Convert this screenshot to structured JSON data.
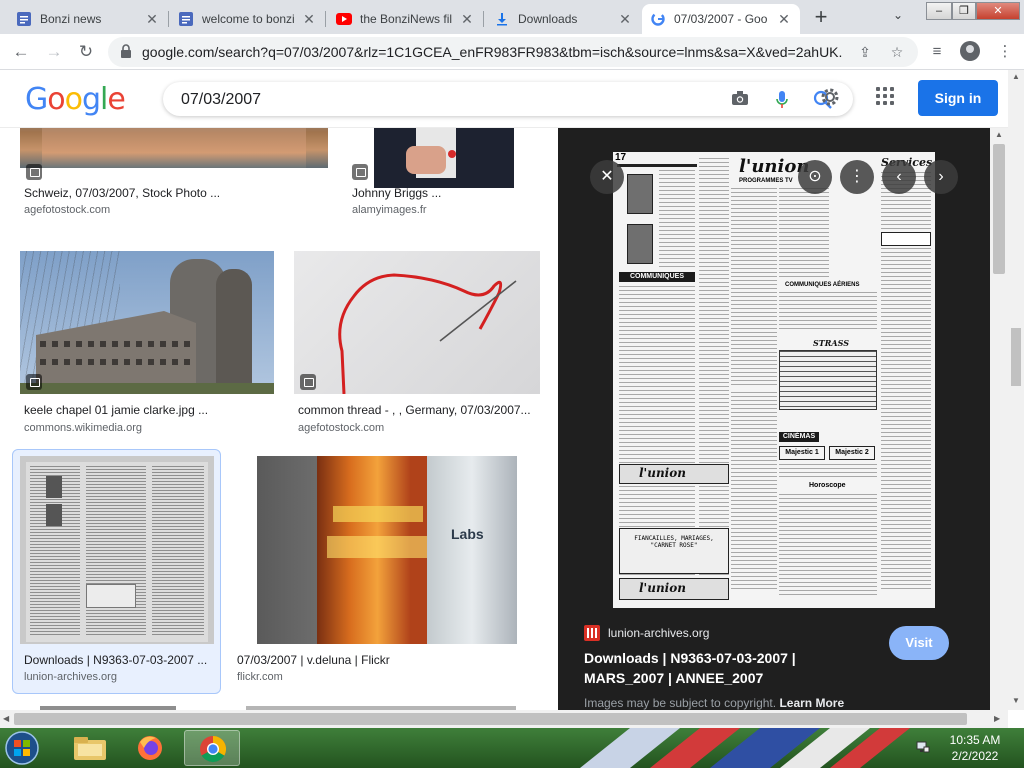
{
  "tabs": [
    {
      "title": "Bonzi news",
      "icon": "docs-icon"
    },
    {
      "title": "welcome to bonzi",
      "icon": "docs-icon"
    },
    {
      "title": "the BonziNews fil",
      "icon": "youtube-icon"
    },
    {
      "title": "Downloads",
      "icon": "download-icon"
    },
    {
      "title": "07/03/2007 - Goo",
      "icon": "google-icon",
      "active": true
    }
  ],
  "window_controls": {
    "minimize": "–",
    "maximize": "❐",
    "close": "✕"
  },
  "address_bar": {
    "url": "google.com/search?q=07/03/2007&rlz=1C1GCEA_enFR983FR983&tbm=isch&source=lnms&sa=X&ved=2ahUK..."
  },
  "google": {
    "logo_letters": [
      {
        "ch": "G",
        "color": "#4285f4"
      },
      {
        "ch": "o",
        "color": "#ea4335"
      },
      {
        "ch": "o",
        "color": "#fbbc05"
      },
      {
        "ch": "g",
        "color": "#4285f4"
      },
      {
        "ch": "l",
        "color": "#34a853"
      },
      {
        "ch": "e",
        "color": "#ea4335"
      }
    ],
    "query": "07/03/2007",
    "signin_label": "Sign in"
  },
  "results": [
    {
      "caption": "Schweiz, 07/03/2007, Stock Photo ...",
      "source": "agefotostock.com"
    },
    {
      "caption": "Johnny Briggs ...",
      "source": "alamyimages.fr"
    },
    {
      "caption": "keele chapel 01 jamie clarke.jpg ...",
      "source": "commons.wikimedia.org"
    },
    {
      "caption": "common thread - , , Germany, 07/03/2007...",
      "source": "agefotostock.com"
    },
    {
      "caption": "Downloads | N9363-07-03-2007 ...",
      "source": "lunion-archives.org"
    },
    {
      "caption": "07/03/2007 | v.deluna | Flickr",
      "source": "flickr.com"
    }
  ],
  "preview": {
    "site": "lunion-archives.org",
    "title": "Downloads | N9363-07-03-2007 | MARS_2007 | ANNEE_2007",
    "visit_label": "Visit",
    "notice": "Images may be subject to copyright.",
    "learn_more": "Learn More",
    "newspaper": {
      "page_no": "17",
      "masthead": "l'union",
      "section": "PROGRAMMES TV",
      "communiques": "COMMUNIQUES",
      "services": "Services",
      "horoscope": "Horoscope",
      "cinemas": "CINÉMAS",
      "majestic1": "Majestic 1",
      "majestic2": "Majestic 2",
      "fiancailles": "FIANCAILLES, MARIAGES,",
      "carnet": "\"CARNET ROSE\"",
      "strass": "STRASS"
    }
  },
  "taskbar": {
    "time": "10:35 AM",
    "date": "2/2/2022"
  }
}
